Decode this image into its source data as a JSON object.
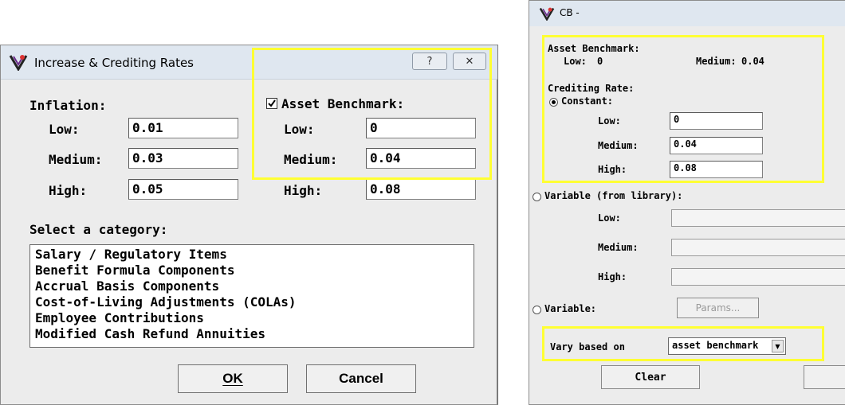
{
  "colors": {
    "highlight": "#ffff33",
    "titlebar": "#dfe7f0",
    "dialog_bg": "#ececec"
  },
  "dialog1": {
    "title": "Increase & Crediting Rates",
    "help_button": "?",
    "close_button": "✕",
    "inflation": {
      "heading": "Inflation:",
      "low_label": "Low:",
      "low_value": "0.01",
      "medium_label": "Medium:",
      "medium_value": "0.03",
      "high_label": "High:",
      "high_value": "0.05"
    },
    "asset_benchmark": {
      "checkbox_label": "Asset Benchmark:",
      "checked": true,
      "low_label": "Low:",
      "low_value": "0",
      "medium_label": "Medium:",
      "medium_value": "0.04",
      "high_label": "High:",
      "high_value": "0.08"
    },
    "category": {
      "heading": "Select a category:",
      "items": [
        "Salary / Regulatory Items",
        "Benefit Formula Components",
        "Accrual Basis Components",
        "Cost-of-Living Adjustments (COLAs)",
        "Employee Contributions",
        "Modified Cash Refund Annuities"
      ]
    },
    "ok_label": "OK",
    "cancel_label": "Cancel"
  },
  "dialog2": {
    "title": "CB -",
    "asset_benchmark_heading": "Asset Benchmark:",
    "ab_low_label": "Low:",
    "ab_low_value": "0",
    "ab_medium_label": "Medium:",
    "ab_medium_value": "0.04",
    "crediting_rate_heading": "Crediting Rate:",
    "constant_label": "Constant:",
    "constant_selected": true,
    "const_low_label": "Low:",
    "const_low_value": "0",
    "const_medium_label": "Medium:",
    "const_medium_value": "0.04",
    "const_high_label": "High:",
    "const_high_value": "0.08",
    "variable_library_label": "Variable (from library):",
    "var_low_label": "Low:",
    "var_medium_label": "Medium:",
    "var_high_label": "High:",
    "variable_label": "Variable:",
    "params_label": "Params...",
    "vary_based_on_label": "Vary based on",
    "vary_based_on_value": "asset benchmark",
    "clear_label": "Clear"
  }
}
